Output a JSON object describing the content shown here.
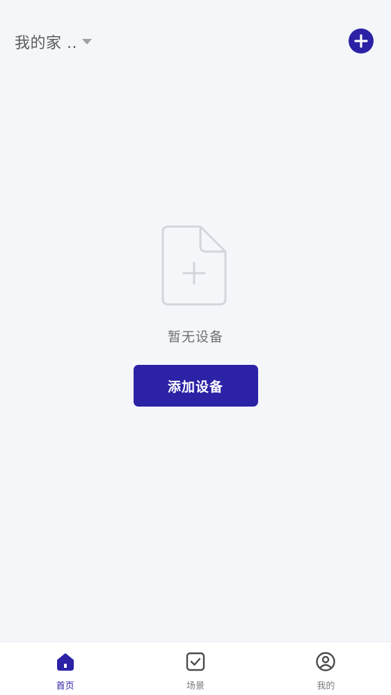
{
  "header": {
    "home_name": "我的家 ..",
    "add_icon": "plus-icon"
  },
  "empty_state": {
    "icon": "file-add-icon",
    "message": "暂无设备",
    "button_label": "添加设备"
  },
  "tabbar": {
    "tabs": [
      {
        "label": "首页",
        "icon": "home-icon",
        "active": true
      },
      {
        "label": "场景",
        "icon": "checkbox-icon",
        "active": false
      },
      {
        "label": "我的",
        "icon": "user-icon",
        "active": false
      }
    ]
  },
  "colors": {
    "accent": "#2b22a6",
    "background": "#f4f6fa",
    "muted_text": "#707070"
  }
}
